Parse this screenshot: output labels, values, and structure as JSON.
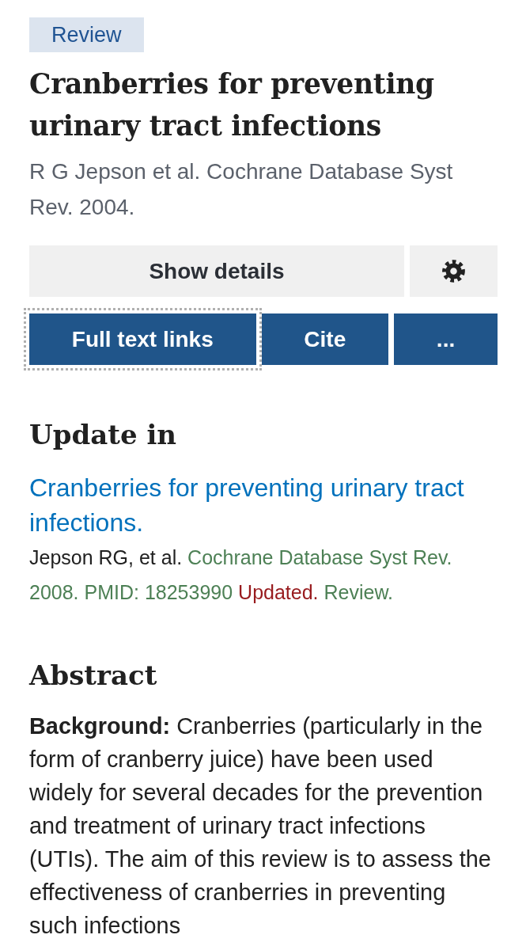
{
  "publication_type": {
    "label": "Review"
  },
  "title": "Cranberries for preventing urinary tract infections",
  "citation": "R G Jepson et al. Cochrane Database Syst Rev. 2004.",
  "toolbar": [
    {
      "kind": "text",
      "label": "Show details"
    },
    {
      "kind": "settings"
    }
  ],
  "actions": [
    {
      "label": "Full text links",
      "focused": true
    },
    {
      "label": "Cite",
      "focused": false
    },
    {
      "label": "...",
      "focused": false
    }
  ],
  "update_in": {
    "heading": "Update in",
    "items": [
      {
        "title": "Cranberries for preventing urinary tract infections.",
        "authors": "Jepson RG, et al.",
        "source": "Cochrane Database Syst Rev. 2008. PMID: 18253990",
        "status": "Updated.",
        "type": "Review."
      }
    ]
  },
  "abstract": {
    "heading": "Abstract",
    "sections": [
      {
        "label": "Background:",
        "text": "Cranberries (particularly in the form of cranberry juice) have been used widely for several decades for the prevention and treatment of urinary tract infections (UTIs). The aim of this review is to assess the effectiveness of cranberries in preventing such infections"
      }
    ]
  }
}
